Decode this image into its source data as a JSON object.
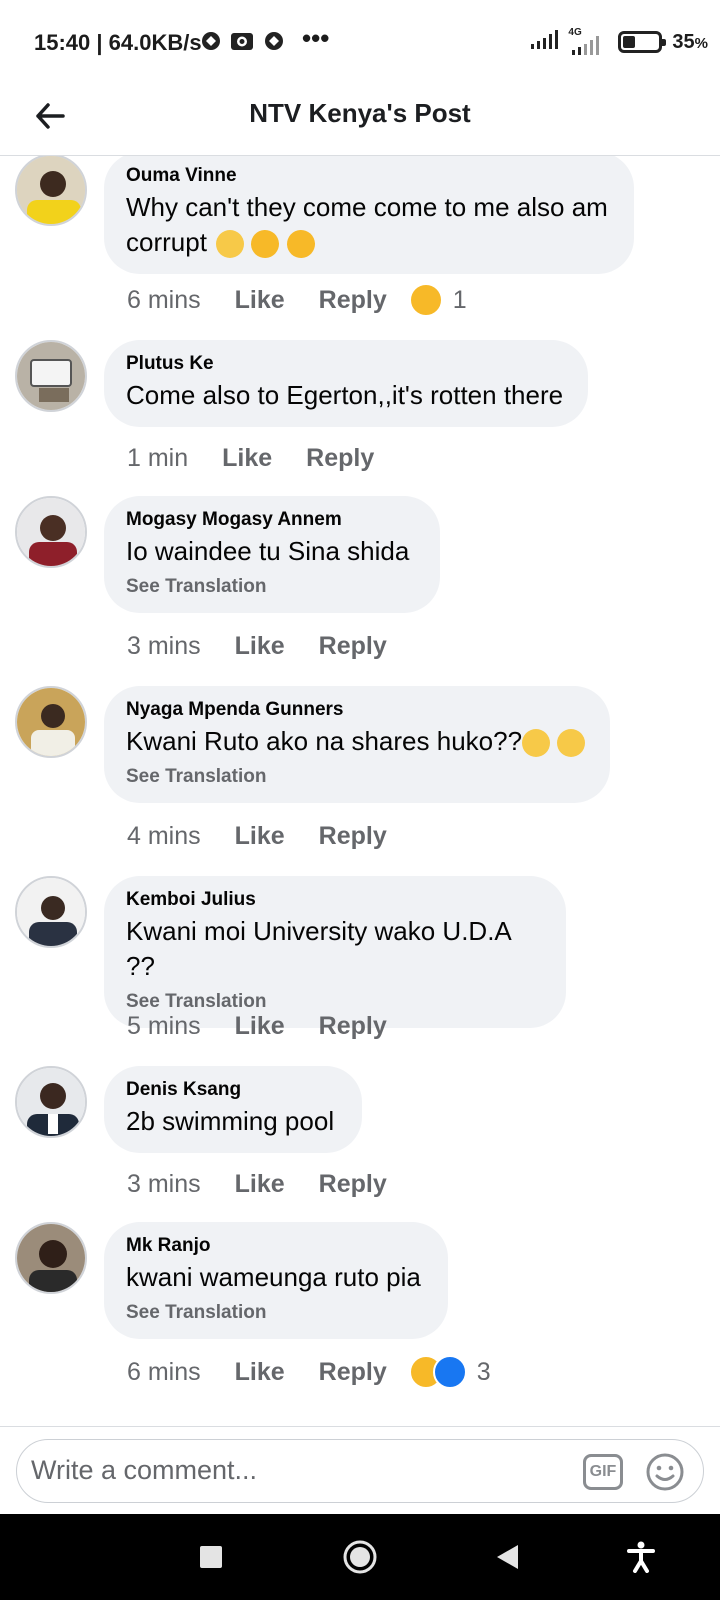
{
  "status_bar": {
    "time": "15:40",
    "net_speed": "| 64.0KB/s",
    "signal_2_label": "4G",
    "battery_pct": "35",
    "battery_unit": "%",
    "battery_level": 0.35
  },
  "header": {
    "title": "NTV Kenya's Post"
  },
  "comments": [
    {
      "author": "Ouma Vinne",
      "text": "Why can't they come come to me also am corrupt",
      "text_line2": "corrupt",
      "time": "6 mins",
      "like": "Like",
      "reply": "Reply",
      "reaction_count": "1"
    },
    {
      "author": "Plutus Ke",
      "text": "Come also to Egerton,,it's rotten there",
      "time": "1 min",
      "like": "Like",
      "reply": "Reply"
    },
    {
      "author": "Mogasy Mogasy Annem",
      "text": "Io waindee tu Sina shida",
      "translation": "See Translation",
      "time": "3 mins",
      "like": "Like",
      "reply": "Reply"
    },
    {
      "author": "Nyaga Mpenda Gunners",
      "text": "Kwani Ruto ako na shares huko??",
      "translation": "See Translation",
      "time": "4 mins",
      "like": "Like",
      "reply": "Reply"
    },
    {
      "author": "Kemboi Julius",
      "text": "Kwani moi University wako U.D.A ??",
      "translation": "See Translation",
      "time": "5 mins",
      "like": "Like",
      "reply": "Reply"
    },
    {
      "author": "Denis Ksang",
      "text": "2b swimming pool",
      "time": "3 mins",
      "like": "Like",
      "reply": "Reply"
    },
    {
      "author": "Mk Ranjo",
      "text": "kwani wameunga ruto pia",
      "translation": "See Translation",
      "time": "6 mins",
      "like": "Like",
      "reply": "Reply",
      "reaction_count": "3"
    }
  ],
  "composer": {
    "placeholder": "Write a comment...",
    "gif_label": "GIF"
  },
  "colors": {
    "bubble": "#f0f2f5",
    "meta_text": "#65676b",
    "like_blue": "#1877f2",
    "haha_yellow": "#f7b928"
  },
  "icons": [
    "back-arrow-icon",
    "gif-icon",
    "emoji-icon",
    "recents-icon",
    "home-icon",
    "back-icon",
    "accessibility-icon"
  ]
}
